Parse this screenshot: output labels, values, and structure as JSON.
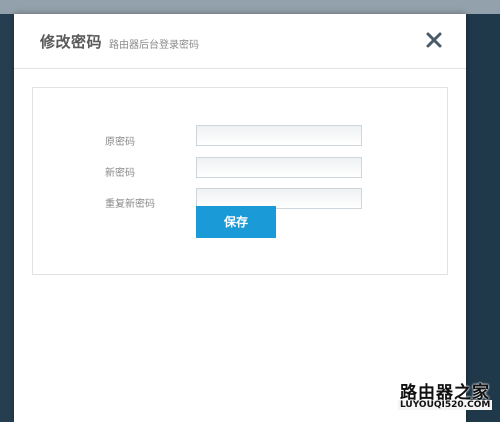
{
  "dialog": {
    "title": "修改密码",
    "subtitle": "路由器后台登录密码",
    "close_icon": "close-icon"
  },
  "form": {
    "fields": [
      {
        "label": "原密码",
        "value": "",
        "placeholder": ""
      },
      {
        "label": "新密码",
        "value": "",
        "placeholder": ""
      },
      {
        "label": "重复新密码",
        "value": "",
        "placeholder": ""
      }
    ],
    "save_label": "保存"
  },
  "watermark": {
    "title": "路由器之家",
    "url": "LUYOUQI520.COM"
  },
  "colors": {
    "accent": "#1a9ad6",
    "title_text": "#5a5a5a",
    "label_text": "#8a8a8a"
  }
}
